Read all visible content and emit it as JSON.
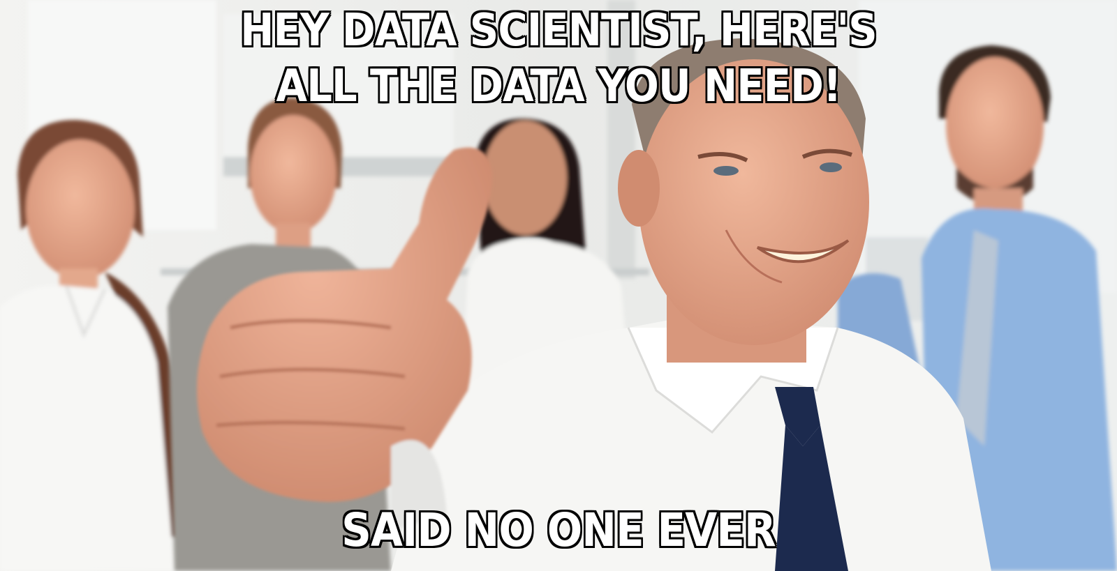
{
  "meme": {
    "top_text_line1": "HEY DATA SCIENTIST, HERE'S",
    "top_text_line2": "ALL THE DATA YOU NEED!",
    "bottom_text": "SAID NO ONE EVER"
  },
  "colors": {
    "caption_fill": "#ffffff",
    "caption_outline": "#000000",
    "background": "#ececea",
    "shirt_white": "#f6f6f4",
    "shirt_blue": "#8fb4e0",
    "tie_navy": "#1c2a4e",
    "skin": "#e0a287",
    "hair_brown": "#6b4330"
  },
  "icons": {
    "thumbs_up": "thumbs-up-icon"
  }
}
